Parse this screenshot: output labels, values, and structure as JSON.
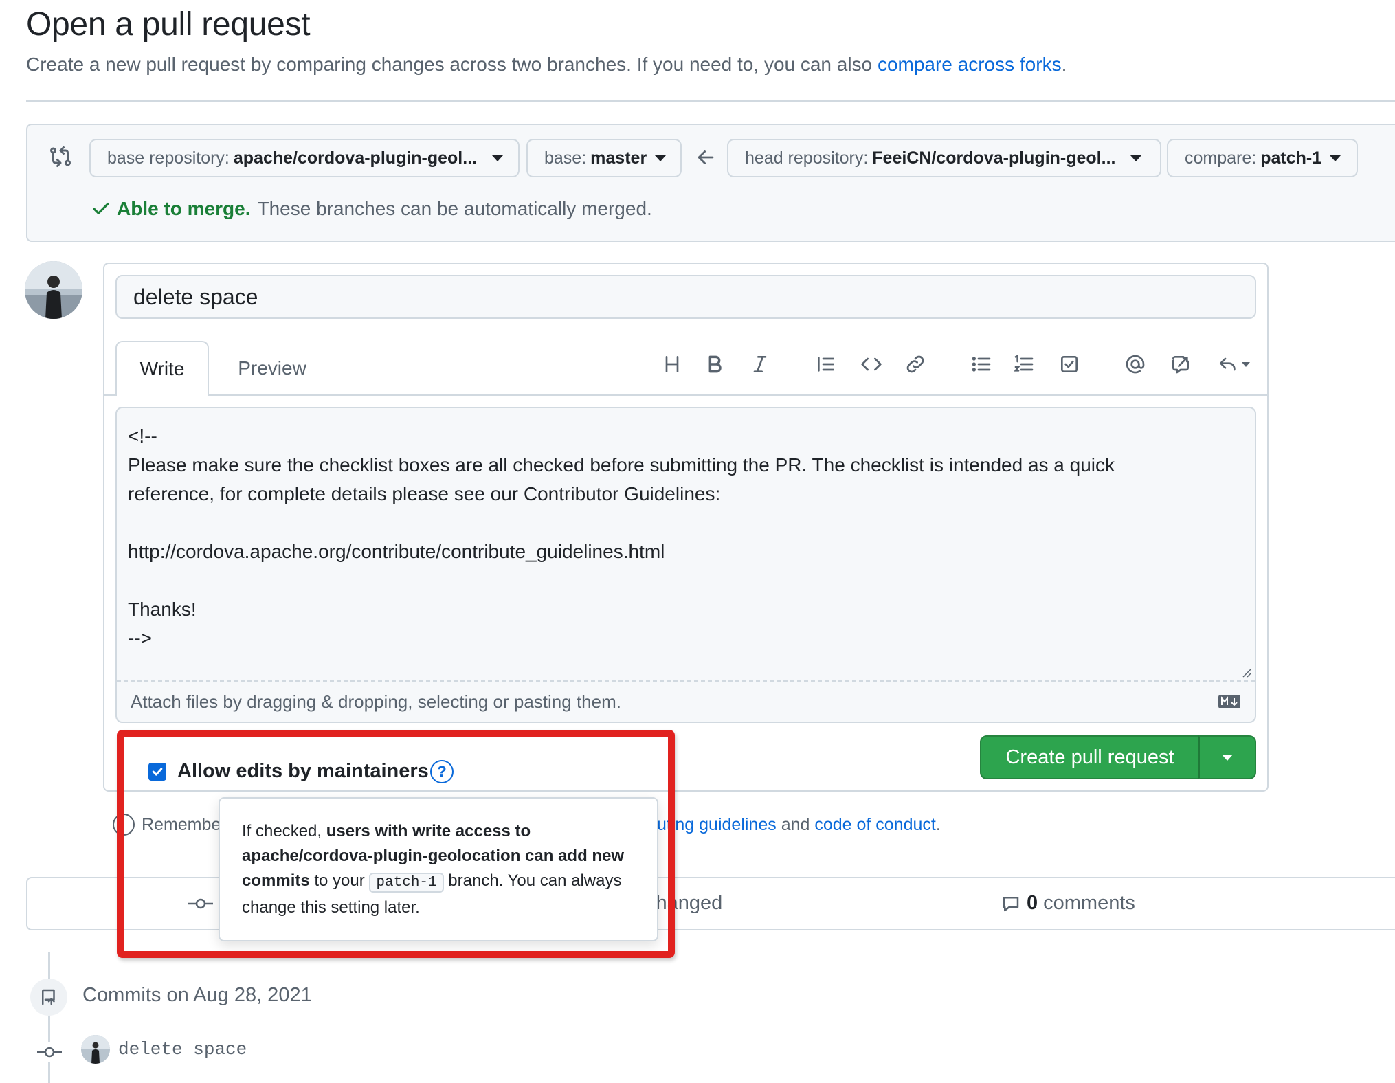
{
  "header": {
    "title": "Open a pull request",
    "subtitle": "Create a new pull request by comparing changes across two branches. If you need to, you can also ",
    "subtitle_link": "compare across forks",
    "subtitle_end": "."
  },
  "compare": {
    "base_repo_label": "base repository:",
    "base_repo_value": "apache/cordova-plugin-geol...",
    "base_label": "base:",
    "base_value": "master",
    "head_repo_label": "head repository:",
    "head_repo_value": "FeeiCN/cordova-plugin-geol...",
    "compare_label": "compare:",
    "compare_value": "patch-1",
    "merge_ok": "Able to merge.",
    "merge_msg": "These branches can be automatically merged."
  },
  "form": {
    "title_value": "delete space",
    "tabs": {
      "write": "Write",
      "preview": "Preview"
    },
    "toolbar_icons": [
      "heading-icon",
      "bold-icon",
      "italic-icon",
      "quote-icon",
      "code-icon",
      "link-icon",
      "bullet-list-icon",
      "numbered-list-icon",
      "task-list-icon",
      "mention-icon",
      "reference-icon",
      "reply-icon"
    ],
    "body": "<!--\nPlease make sure the checklist boxes are all checked before submitting the PR. The checklist is intended as a quick\nreference, for complete details please see our Contributor Guidelines:\n\nhttp://cordova.apache.org/contribute/contribute_guidelines.html\n\nThanks!\n-->",
    "attach_text": "Attach files by dragging & dropping, selecting or pasting them.",
    "create_button": "Create pull request",
    "allow_edits_label": "Allow edits by maintainers",
    "allow_edits_checked": true,
    "help_glyph": "?"
  },
  "remember": {
    "text": "Remembe",
    "guidelines_partial": "uting guidelines",
    "and": " and ",
    "conduct_link": "code of conduct",
    "end": "."
  },
  "tooltip": {
    "prefix": "If checked, ",
    "bold1": "users with write access to apache/cordova-plugin-geolocation can add new commits",
    "middle": " to your ",
    "branch_code": "patch-1",
    "suffix": " branch. You can always change this setting later."
  },
  "stats": {
    "files_changed_partial": "changed",
    "comments_count": "0",
    "comments_label": "comments"
  },
  "timeline": {
    "commits_date": "Commits on Aug 28, 2021",
    "commit_message": "delete space"
  },
  "colors": {
    "accent": "#0969da",
    "success": "#1a7f37",
    "button_green": "#2da44e",
    "highlight_red": "#e1221f"
  }
}
